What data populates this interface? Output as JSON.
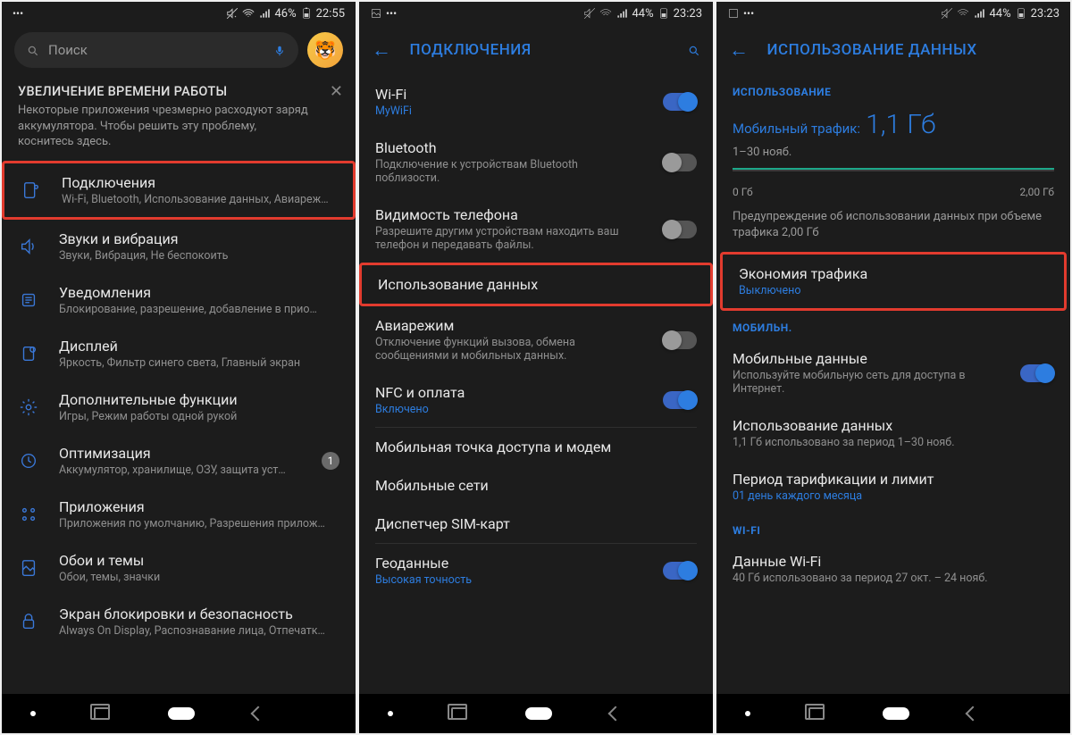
{
  "screen1": {
    "status": {
      "battery": "46%",
      "time": "22:55"
    },
    "search_placeholder": "Поиск",
    "banner": {
      "title": "УВЕЛИЧЕНИЕ ВРЕМЕНИ РАБОТЫ",
      "text": "Некоторые приложения чрезмерно расходуют заряд аккумулятора. Чтобы решить эту проблему, коснитесь здесь."
    },
    "items": [
      {
        "title": "Подключения",
        "sub": "Wi-Fi, Bluetooth, Использование данных, Авиареж…",
        "highlight": true
      },
      {
        "title": "Звуки и вибрация",
        "sub": "Звуки, Вибрация, Не беспокоить"
      },
      {
        "title": "Уведомления",
        "sub": "Блокирование, разрешение, добавление в прио…"
      },
      {
        "title": "Дисплей",
        "sub": "Яркость, Фильтр синего света, Главный экран"
      },
      {
        "title": "Дополнительные функции",
        "sub": "Игры, Режим работы одной рукой"
      },
      {
        "title": "Оптимизация",
        "sub": "Аккумулятор, хранилище, ОЗУ, защита уст…",
        "badge": "1"
      },
      {
        "title": "Приложения",
        "sub": "Приложения по умолчанию, Разрешения прилож…"
      },
      {
        "title": "Обои и темы",
        "sub": "Обои, темы, значки"
      },
      {
        "title": "Экран блокировки и безопасность",
        "sub": "Always On Display, Распознавание лица, Отпечатк…"
      }
    ]
  },
  "screen2": {
    "status": {
      "battery": "44%",
      "time": "23:23"
    },
    "header": "ПОДКЛЮЧЕНИЯ",
    "items": [
      {
        "title": "Wi-Fi",
        "sub": "MyWiFi",
        "subBlue": true,
        "toggle": "on"
      },
      {
        "title": "Bluetooth",
        "sub": "Подключение к устройствам Bluetooth поблизости.",
        "toggle": "off"
      },
      {
        "title": "Видимость телефона",
        "sub": "Разрешите другим устройствам находить ваш телефон и передавать файлы.",
        "toggle": "off"
      },
      {
        "title": "Использование данных",
        "highlight": true
      },
      {
        "title": "Авиарежим",
        "sub": "Отключение функций вызова, обмена сообщениями и мобильных данных.",
        "toggle": "off"
      },
      {
        "title": "NFC и оплата",
        "sub": "Включено",
        "subBlue": true,
        "toggle": "on"
      },
      {
        "title": "Мобильная точка доступа и модем"
      },
      {
        "title": "Мобильные сети"
      },
      {
        "title": "Диспетчер SIM-карт"
      },
      {
        "title": "Геоданные",
        "sub": "Высокая точность",
        "subBlue": true,
        "toggle": "on"
      }
    ]
  },
  "screen3": {
    "status": {
      "battery": "44%",
      "time": "23:23"
    },
    "header": "ИСПОЛЬЗОВАНИЕ ДАННЫХ",
    "section_usage": "ИСПОЛЬЗОВАНИЕ",
    "usage_label": "Мобильный трафик:",
    "usage_value": "1,1 Гб",
    "usage_period": "1–30 нояб.",
    "bar_min": "0 Гб",
    "bar_max": "2,00 Гб",
    "warn": "Предупреждение об использовании данных при объеме трафика 2,00 Гб",
    "data_saver": {
      "title": "Экономия трафика",
      "sub": "Выключено"
    },
    "section_mobile": "МОБИЛЬН.",
    "mobile_data": {
      "title": "Мобильные данные",
      "sub": "Используйте мобильную сеть для доступа в Интернет."
    },
    "mobile_usage": {
      "title": "Использование данных",
      "sub": "1,1 Гб использовано за период 1–30 нояб."
    },
    "billing": {
      "title": "Период тарификации и лимит",
      "sub": "01 день каждого месяца"
    },
    "section_wifi": "WI-FI",
    "wifi_data": {
      "title": "Данные Wi-Fi",
      "sub": "40 Гб использовано за период 27 окт. – 24 нояб."
    }
  }
}
